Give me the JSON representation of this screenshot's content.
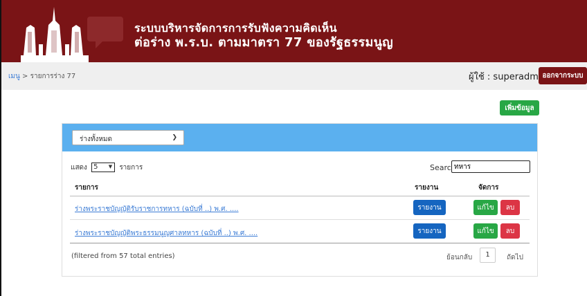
{
  "header": {
    "title_line1": "ระบบบริหารจัดการการรับฟังความคิดเห็น",
    "title_line2": "ต่อร่าง พ.ร.บ. ตามมาตรา 77 ของรัฐธรรมนูญ"
  },
  "breadcrumb": {
    "menu": "เมนู",
    "separator": ">",
    "current": "รายการร่าง 77"
  },
  "user": {
    "label": "ผู้ใช้ : superadmin",
    "logout": "ออกจากระบบ"
  },
  "add_button": "เพิ่มข้อมูล",
  "filter": {
    "selected": "ร่างทั้งหมด"
  },
  "table_controls": {
    "show_label": "แสดง",
    "entries_value": "5",
    "entries_suffix": "รายการ",
    "search_label": "Search:",
    "search_value": "ทหาร"
  },
  "table": {
    "headers": [
      "รายการ",
      "รายงาน",
      "จัดการ"
    ],
    "rows": [
      {
        "title": "ร่างพระราชบัญญัติรับราชการทหาร (ฉบับที่ ..) พ.ศ. ....",
        "report": "รายงาน",
        "edit": "แก้ไข",
        "delete": "ลบ"
      },
      {
        "title": "ร่างพระราชบัญญัติพระธรรมนูญศาลทหาร (ฉบับที่ ..) พ.ศ. ....",
        "report": "รายงาน",
        "edit": "แก้ไข",
        "delete": "ลบ"
      }
    ]
  },
  "pagination": {
    "info": "(filtered from 57 total entries)",
    "previous": "ย้อนกลับ",
    "page": "1",
    "next": "ถัดไป"
  },
  "colors": {
    "brand": "#7a1416",
    "card_header": "#5bb0ef",
    "success": "#28a745",
    "primary": "#1565c0",
    "danger": "#dc3545"
  }
}
